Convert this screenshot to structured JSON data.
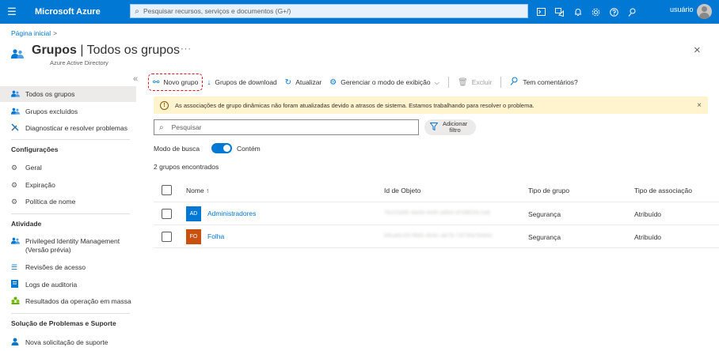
{
  "topbar": {
    "brand": "Microsoft Azure",
    "search_placeholder": "Pesquisar recursos, serviços e documentos (G+/)",
    "user": "usuário",
    "color": "#0078d4"
  },
  "header": {
    "breadcrumb": "Página inicial",
    "title_bold": "Grupos",
    "title_rest": " | Todos os grupos",
    "subtitle": "Azure Active Directory",
    "more": "···",
    "close": "×"
  },
  "sidebar": {
    "collapse": "«",
    "items": [
      {
        "label": "Todos os grupos"
      },
      {
        "label": "Grupos excluídos"
      },
      {
        "label": "Diagnosticar e resolver problemas"
      }
    ],
    "section_config": "Configurações",
    "config_items": [
      {
        "label": "Geral"
      },
      {
        "label": "Expiração"
      },
      {
        "label": "Política de nome"
      }
    ],
    "section_activity": "Atividade",
    "activity_items": [
      {
        "label": "Privileged Identity Management",
        "label2": "(Versão prévia)"
      },
      {
        "label": "Revisões de acesso"
      },
      {
        "label": "Logs de auditoria"
      },
      {
        "label": "Resultados da operação em massa"
      }
    ],
    "section_support": "Solução de Problemas e Suporte",
    "support_items": [
      {
        "label": "Nova solicitação de suporte"
      }
    ]
  },
  "toolbar": {
    "new_group": "Novo grupo",
    "download": "Grupos de download",
    "refresh": "Atualizar",
    "manage_view": "Gerenciar o modo de exibição",
    "delete": "Excluir",
    "feedback": "Tem comentários?"
  },
  "warning": {
    "text": "As associações de grupo dinâmicas não foram atualizadas devido a atrasos de sistema. Estamos trabalhando para resolver o problema.",
    "close": "×"
  },
  "list": {
    "search_placeholder": "Pesquisar",
    "filter_label_1": "Adicionar",
    "filter_label_2": "filtro",
    "mode_label": "Modo de busca",
    "toggle_label": "Contém",
    "count": "2 grupos encontrados"
  },
  "table": {
    "headers": {
      "name": "Nome ↑",
      "object_id": "Id de Objeto",
      "group_type": "Tipo de grupo",
      "membership_type": "Tipo de associação"
    },
    "rows": [
      {
        "initials": "AD",
        "name": "Administradores",
        "object_id": "7b1f2a95-4a4d-4e6f-a8b4-d7d8f20c1a6",
        "group_type": "Segurança",
        "membership_type": "Atribuído",
        "badge_color": "#0078d4"
      },
      {
        "initials": "FO",
        "name": "Folha",
        "object_id": "b6ca6c33-f8b5-4b4c-ab7b-7d73fa7bfd4c",
        "group_type": "Segurança",
        "membership_type": "Atribuído",
        "badge_color": "#ca5010"
      }
    ]
  }
}
